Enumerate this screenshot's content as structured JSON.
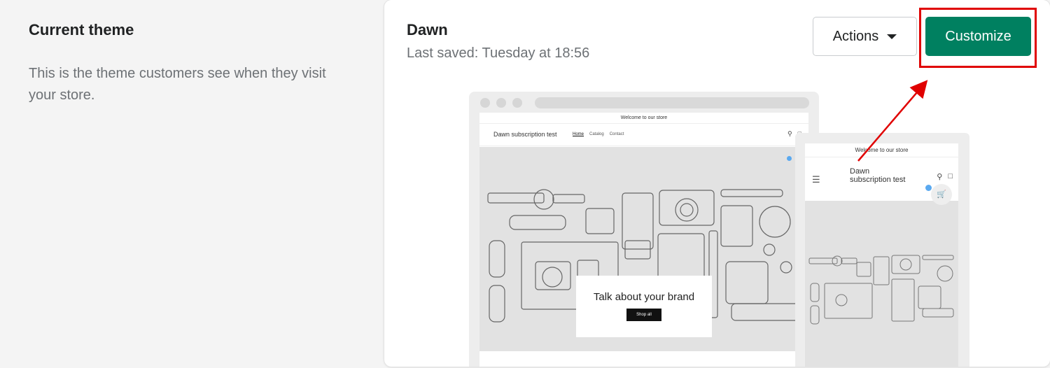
{
  "left": {
    "title": "Current theme",
    "description": "This is the theme customers see when they visit your store."
  },
  "theme": {
    "name": "Dawn",
    "last_saved": "Last saved: Tuesday at 18:56",
    "actions_label": "Actions",
    "customize_label": "Customize",
    "accent_color": "#008060",
    "highlight_color": "#e00000"
  },
  "preview": {
    "announcement": "Welcome to our store",
    "store_name": "Dawn subscription test",
    "nav": [
      "Home",
      "Catalog",
      "Contact"
    ],
    "hero_heading": "Talk about your brand",
    "hero_button": "Shop all",
    "mobile_announcement": "Welcome to our store",
    "mobile_store_name": "Dawn subscription test"
  }
}
